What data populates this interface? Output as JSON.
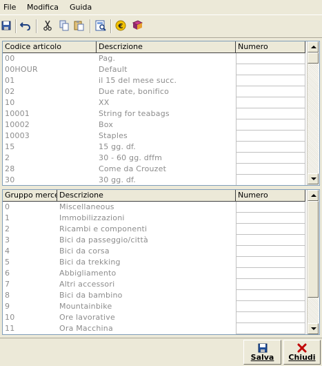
{
  "menu": [
    "File",
    "Modifica",
    "Guida"
  ],
  "toolbar": {
    "icons": [
      "save-icon",
      "undo-icon",
      "cut-icon",
      "copy-icon",
      "paste-icon",
      "preview-icon",
      "euro-icon",
      "book-icon"
    ]
  },
  "grid1": {
    "headers": [
      "Codice articolo",
      "Descrizione",
      "Numero"
    ],
    "rows": [
      [
        "00",
        "Pag."
      ],
      [
        "00HOUR",
        "Default"
      ],
      [
        "01",
        "il 15 del mese succ."
      ],
      [
        "02",
        "Due rate, bonifico"
      ],
      [
        "10",
        "XX"
      ],
      [
        "10001",
        "String for teabags"
      ],
      [
        "10002",
        "Box"
      ],
      [
        "10003",
        "Staples"
      ],
      [
        "15",
        "15 gg. df."
      ],
      [
        "2",
        "30 - 60 gg. dffm"
      ],
      [
        "28",
        "Come da Crouzet"
      ],
      [
        "30",
        "30 gg. df."
      ]
    ]
  },
  "grid2": {
    "headers": [
      "Gruppo merce",
      "Descrizione",
      "Numero"
    ],
    "rows": [
      [
        "0",
        "Miscellaneous"
      ],
      [
        "1",
        "Immobilizzazioni"
      ],
      [
        "2",
        "Ricambi e componenti"
      ],
      [
        "3",
        "Bici da passeggio/città"
      ],
      [
        "4",
        "Bici da corsa"
      ],
      [
        "5",
        "Bici da trekking"
      ],
      [
        "6",
        "Abbigliamento"
      ],
      [
        "7",
        "Altri accessori"
      ],
      [
        "8",
        "Bici da bambino"
      ],
      [
        "9",
        "Mountainbike"
      ],
      [
        "10",
        "Ore lavorative"
      ],
      [
        "11",
        "Ora Macchina"
      ]
    ]
  },
  "buttons": {
    "save": "Salva",
    "close": "Chiudi"
  },
  "colors": {
    "window_bg": "#ECE9D8",
    "cell_text": "#8C8C8C",
    "close_icon": "#C00000",
    "save_icon": "#1F4E99"
  }
}
